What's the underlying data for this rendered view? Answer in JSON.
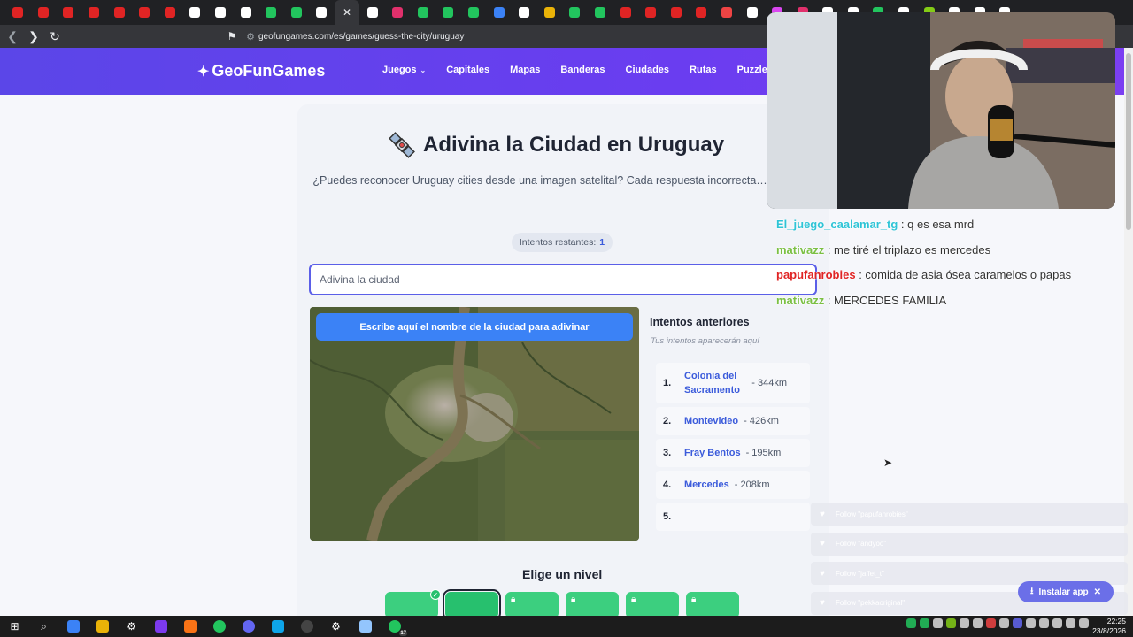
{
  "browser": {
    "url": "geofungames.com/es/games/guess-the-city/uruguay",
    "tab_colors": [
      "#e02424",
      "#e02424",
      "#e02424",
      "#e02424",
      "#e02424",
      "#e02424",
      "#e02424",
      "#ffffff",
      "#ffffff",
      "#ffffff",
      "#22c55e",
      "#22c55e",
      "#ffffff",
      "#ffffff",
      "#e1306c",
      "#22c55e",
      "#22c55e",
      "#22c55e",
      "#3b82f6",
      "#ffffff",
      "#eab308",
      "#22c55e",
      "#22c55e",
      "#e02424",
      "#e02424",
      "#e02424",
      "#e02424",
      "#ef4444",
      "#ffffff",
      "#d946ef",
      "#e1306c",
      "#ffffff",
      "#ffffff",
      "#22c55e",
      "#ffffff",
      "#84cc16",
      "#ffffff",
      "#ffffff",
      "#ffffff"
    ],
    "close_tab": "✕"
  },
  "header": {
    "logo": "GeoFunGames",
    "nav": [
      {
        "label": "Juegos",
        "caret": "⌄"
      },
      {
        "label": "Capitales"
      },
      {
        "label": "Mapas"
      },
      {
        "label": "Banderas"
      },
      {
        "label": "Ciudades"
      },
      {
        "label": "Rutas"
      },
      {
        "label": "Puzzle"
      }
    ]
  },
  "game": {
    "title": "Adivina la Ciudad en Uruguay",
    "subtitle": "¿Puedes reconocer Uruguay cities desde una imagen satelital? Cada respuesta incorrecta… la vista.",
    "attempts_label": "Intentos restantes:",
    "attempts_value": "1",
    "input_placeholder": "Adivina la ciudad",
    "hint_button": "Escribe aquí el nombre de la ciudad para adivinar",
    "previous_title": "Intentos anteriores",
    "previous_hint": "Tus intentos aparecerán aquí",
    "guesses": [
      {
        "num": "1.",
        "city": "Colonia del Sacramento",
        "dist": "- 344km"
      },
      {
        "num": "2.",
        "city": "Montevideo",
        "dist": "- 426km"
      },
      {
        "num": "3.",
        "city": "Fray Bentos",
        "dist": "- 195km"
      },
      {
        "num": "4.",
        "city": "Mercedes",
        "dist": "- 208km"
      },
      {
        "num": "5.",
        "city": "",
        "dist": ""
      }
    ],
    "level_title": "Elige un nivel"
  },
  "chat": [
    {
      "user": "El_juego_caalamar_tg",
      "color": "#2ec4d6",
      "msg": ": q es esa mrd"
    },
    {
      "user": "mativazz",
      "color": "#7bc043",
      "msg": ": me tiré el triplazo es mercedes"
    },
    {
      "user": "papufanrobies",
      "color": "#e02424",
      "msg": ": comida de asia ósea caramelos o papas"
    },
    {
      "user": "mativazz",
      "color": "#7bc043",
      "msg": ": MERCEDES FAMILIA"
    }
  ],
  "follows": [
    "Follow \"papufanrobies\"",
    "Follow \"andyoo\"",
    "Follow \"jaffet_t\"",
    "Follow \"pekkaoriginal\""
  ],
  "install_app": "Instalar app",
  "install_close": "✕",
  "taskbar": {
    "time": "22:25",
    "date": "23/8/2026",
    "badge": "17"
  }
}
